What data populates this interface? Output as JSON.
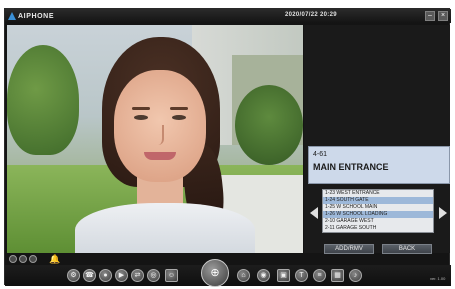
{
  "app": {
    "brand": "AIPHONE",
    "datetime": "2020/07/22  20:29",
    "window_controls": {
      "minimize": "–",
      "close": "×"
    }
  },
  "station": {
    "id": "4-61",
    "name": "MAIN ENTRANCE"
  },
  "station_list": [
    {
      "label": "1-23 WEST ENTRANCE",
      "selected": false
    },
    {
      "label": "1-24 SOUTH GATE",
      "selected": true
    },
    {
      "label": "1-25 W SCHOOL MAIN",
      "selected": false
    },
    {
      "label": "1-26 W SCHOOL LOADING",
      "selected": true
    },
    {
      "label": "2-10 GARAGE WEST",
      "selected": false
    },
    {
      "label": "2-11 GARAGE SOUTH",
      "selected": false
    }
  ],
  "buttons": {
    "add_rmv": "ADD/RMV",
    "back": "BACK"
  },
  "toolbar": {
    "icons": [
      "settings-icon",
      "call-icon",
      "record-icon",
      "play-icon",
      "share-icon",
      "intercom-icon",
      "person-icon",
      "zoom-icon",
      "door-release-icon",
      "camera-icon",
      "snapshot-icon",
      "text-icon",
      "scan-icon",
      "grid-icon",
      "volume-icon"
    ],
    "zoom_glyph": "⊕"
  },
  "version": "ver. 1.00"
}
